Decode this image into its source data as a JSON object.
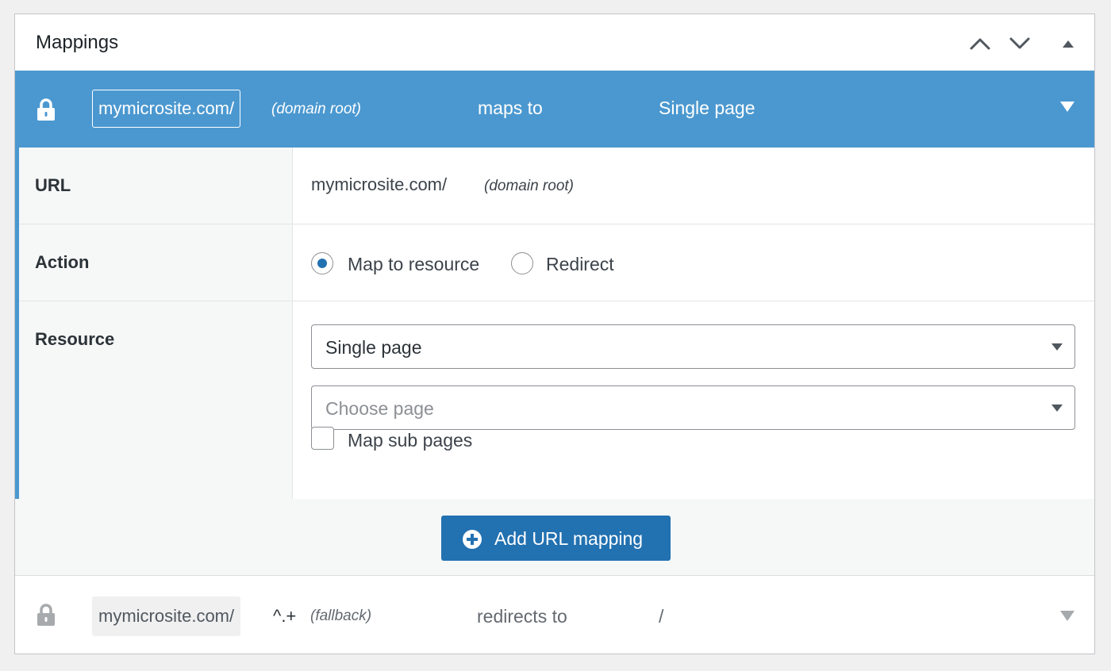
{
  "panel": {
    "title": "Mappings",
    "controls": [
      "chevron-up-icon",
      "chevron-down-icon",
      "triangle-up-icon"
    ]
  },
  "mapping_1": {
    "url": "mymicrosite.com/",
    "note": "(domain root)",
    "verb": "maps to",
    "target": "Single page",
    "expanded": true,
    "fields": {
      "url_label": "URL",
      "url_value": "mymicrosite.com/",
      "url_note": "(domain root)",
      "action_label": "Action",
      "action_options": [
        "Map to resource",
        "Redirect"
      ],
      "action_selected": "Map to resource",
      "resource_label": "Resource",
      "resource_type": "Single page",
      "page_placeholder": "Choose page",
      "sub_pages_label": "Map sub pages",
      "sub_pages_checked": false
    }
  },
  "add_button": {
    "label": "Add URL mapping"
  },
  "mapping_2": {
    "url": "mymicrosite.com/",
    "pattern": "^.+",
    "note": "(fallback)",
    "verb": "redirects to",
    "target": "/",
    "expanded": false
  },
  "colors": {
    "accent": "#4b98d0",
    "button": "#2271b1",
    "background": "#f0f0f1"
  }
}
